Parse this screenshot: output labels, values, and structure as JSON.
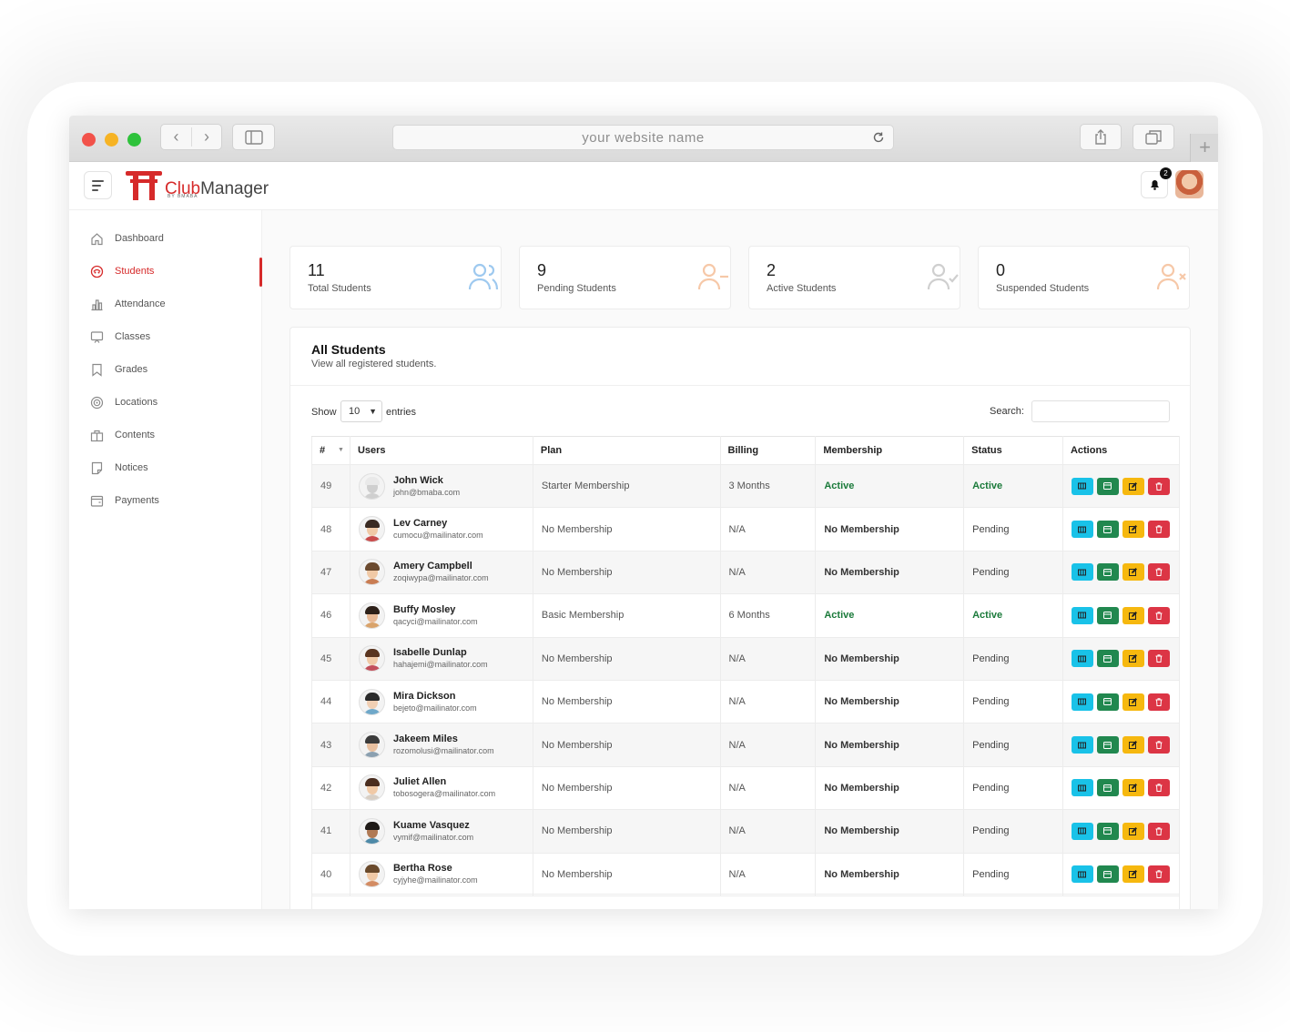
{
  "browser": {
    "url_text": "your website name",
    "back_glyph": "‹",
    "forward_glyph": "›",
    "plus_glyph": "+"
  },
  "app": {
    "logo_club": "Club",
    "logo_manager": "Manager",
    "logo_sub": "BY BMABA",
    "notification_count": "2"
  },
  "sidebar": {
    "items": [
      {
        "label": "Dashboard",
        "icon": "home-icon"
      },
      {
        "label": "Students",
        "icon": "student-icon"
      },
      {
        "label": "Attendance",
        "icon": "chart-icon"
      },
      {
        "label": "Classes",
        "icon": "board-icon"
      },
      {
        "label": "Grades",
        "icon": "bookmark-icon"
      },
      {
        "label": "Locations",
        "icon": "target-icon"
      },
      {
        "label": "Contents",
        "icon": "box-icon"
      },
      {
        "label": "Notices",
        "icon": "note-icon"
      },
      {
        "label": "Payments",
        "icon": "wallet-icon"
      }
    ],
    "active": "Students"
  },
  "stats": [
    {
      "value": "11",
      "label": "Total Students",
      "color": "#9ec9ef"
    },
    {
      "value": "9",
      "label": "Pending Students",
      "color": "#f6c8a8"
    },
    {
      "value": "2",
      "label": "Active Students",
      "color": "#cfcfcf"
    },
    {
      "value": "0",
      "label": "Suspended Students",
      "color": "#f6c8a8"
    }
  ],
  "table_card": {
    "title": "All Students",
    "subtitle": "View all registered students.",
    "show_label": "Show",
    "entries_value": "10",
    "entries_label": "entries",
    "search_label": "Search:"
  },
  "table": {
    "headers": [
      "#",
      "Users",
      "Plan",
      "Billing",
      "Membership",
      "Status",
      "Actions"
    ],
    "rows": [
      {
        "num": "49",
        "name": "John Wick",
        "email": "john@bmaba.com",
        "plan": "Starter Membership",
        "billing": "3 Months",
        "membership": "Active",
        "status": "Active"
      },
      {
        "num": "48",
        "name": "Lev Carney",
        "email": "cumocu@mailinator.com",
        "plan": "No Membership",
        "billing": "N/A",
        "membership": "No Membership",
        "status": "Pending"
      },
      {
        "num": "47",
        "name": "Amery Campbell",
        "email": "zoqiwypa@mailinator.com",
        "plan": "No Membership",
        "billing": "N/A",
        "membership": "No Membership",
        "status": "Pending"
      },
      {
        "num": "46",
        "name": "Buffy Mosley",
        "email": "qacyci@mailinator.com",
        "plan": "Basic Membership",
        "billing": "6 Months",
        "membership": "Active",
        "status": "Active"
      },
      {
        "num": "45",
        "name": "Isabelle Dunlap",
        "email": "hahajemi@mailinator.com",
        "plan": "No Membership",
        "billing": "N/A",
        "membership": "No Membership",
        "status": "Pending"
      },
      {
        "num": "44",
        "name": "Mira Dickson",
        "email": "bejeto@mailinator.com",
        "plan": "No Membership",
        "billing": "N/A",
        "membership": "No Membership",
        "status": "Pending"
      },
      {
        "num": "43",
        "name": "Jakeem Miles",
        "email": "rozomolusi@mailinator.com",
        "plan": "No Membership",
        "billing": "N/A",
        "membership": "No Membership",
        "status": "Pending"
      },
      {
        "num": "42",
        "name": "Juliet Allen",
        "email": "tobosogera@mailinator.com",
        "plan": "No Membership",
        "billing": "N/A",
        "membership": "No Membership",
        "status": "Pending"
      },
      {
        "num": "41",
        "name": "Kuame Vasquez",
        "email": "vymif@mailinator.com",
        "plan": "No Membership",
        "billing": "N/A",
        "membership": "No Membership",
        "status": "Pending"
      },
      {
        "num": "40",
        "name": "Bertha Rose",
        "email": "cyjyhe@mailinator.com",
        "plan": "No Membership",
        "billing": "N/A",
        "membership": "No Membership",
        "status": "Pending"
      }
    ],
    "action_icons": [
      "id-card-icon",
      "wallet-icon",
      "edit-icon",
      "trash-icon"
    ],
    "action_colors": [
      "#19c2e8",
      "#21884f",
      "#f6b80f",
      "#dc3545"
    ]
  }
}
